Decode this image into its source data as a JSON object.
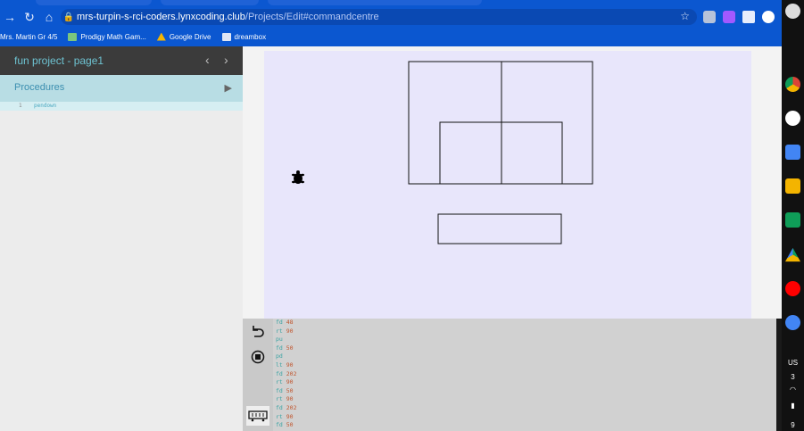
{
  "browser": {
    "url_host": "mrs-turpin-s-rci-coders.lynxcoding.club",
    "url_path": "/Projects/Edit#commandcentre",
    "bookmarks": [
      {
        "label": "Mrs. Martin Gr 4/5",
        "icon": "bookmark-icon",
        "color": "#0b57d0"
      },
      {
        "label": "Prodigy Math Gam...",
        "icon": "prodigy-icon",
        "color": "#7bc67e"
      },
      {
        "label": "Google Drive",
        "icon": "drive-icon",
        "color": "#f4b400"
      },
      {
        "label": "dreambox",
        "icon": "folder-icon",
        "color": "#dfe6f5"
      }
    ]
  },
  "project": {
    "title": "fun project - page1",
    "prev_glyph": "‹",
    "next_glyph": "›"
  },
  "procedures": {
    "label": "Procedures",
    "arrow_glyph": "▶",
    "line_number": "1",
    "code": "pendown"
  },
  "command_centre": {
    "lines": [
      {
        "cmd": "fd",
        "arg": "48"
      },
      {
        "cmd": "rt",
        "arg": "90"
      },
      {
        "cmd": "pu",
        "arg": ""
      },
      {
        "cmd": "fd",
        "arg": "50"
      },
      {
        "cmd": "pd",
        "arg": ""
      },
      {
        "cmd": "lt",
        "arg": "90"
      },
      {
        "cmd": "fd",
        "arg": "202"
      },
      {
        "cmd": "rt",
        "arg": "90"
      },
      {
        "cmd": "fd",
        "arg": "50"
      },
      {
        "cmd": "rt",
        "arg": "90"
      },
      {
        "cmd": "fd",
        "arg": "202"
      },
      {
        "cmd": "rt",
        "arg": "90"
      },
      {
        "cmd": "fd",
        "arg": "50"
      }
    ]
  },
  "shelf": {
    "locale": "US",
    "badge": "3",
    "battery_level": "9"
  },
  "colors": {
    "browser_blue": "#0b57d0",
    "header_dark": "#3b3b3b",
    "title_teal": "#6ec3d2",
    "procedures_bg": "#b8dde4",
    "canvas_bg": "#e8e6fb",
    "cmd_color": "#3aa3a3",
    "arg_color": "#c0562f"
  }
}
